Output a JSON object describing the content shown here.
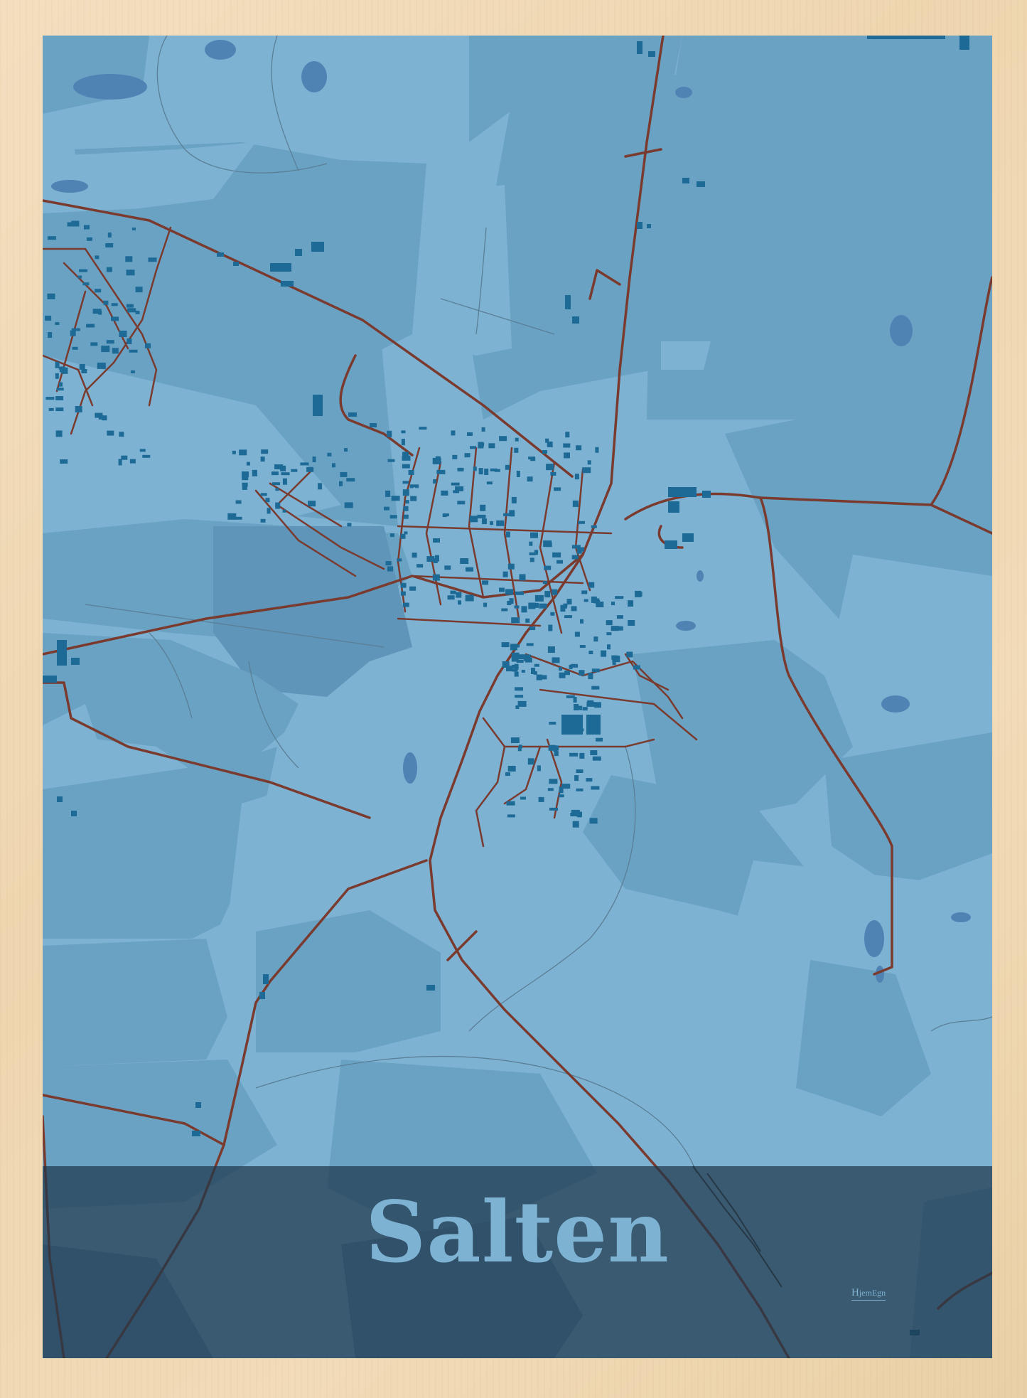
{
  "poster": {
    "town_name": "Salten",
    "brand": {
      "initial": "H",
      "rest": "jemEgn"
    }
  },
  "colors": {
    "frame": "#f1dbb8",
    "land_light": "#7db2d3",
    "land_mid": "#6aa2c4",
    "land_dark": "#5e95b8",
    "buildings": "#1d6a96",
    "water": "#4f83b3",
    "roads": "#7a3a2e",
    "paths": "#5a7f96",
    "title_band": "#2d4a5e",
    "title_text": "#7db2d3"
  },
  "map_features": {
    "roads": "road-network",
    "buildings": "building-footprints",
    "water": "lakes-and-ponds",
    "fields": "field-parcels",
    "railway": "railway-line"
  }
}
